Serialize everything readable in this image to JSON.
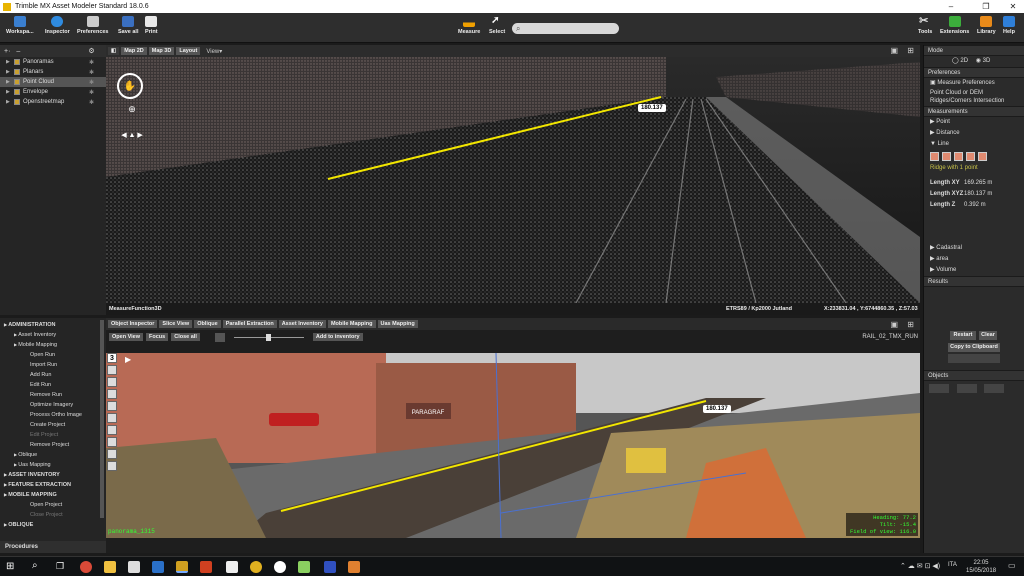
{
  "window": {
    "title": "Trimble MX Asset Modeler Standard 18.0.6"
  },
  "toolbar": {
    "workspace": "Workspa...",
    "inspector": "Inspector",
    "preferences": "Preferences",
    "save_all": "Save all",
    "print": "Print",
    "measure": "Measure",
    "select": "Select",
    "tools": "Tools",
    "extensions": "Extensions",
    "library": "Library",
    "help": "Help"
  },
  "layers": {
    "items": [
      {
        "label": "Panoramas"
      },
      {
        "label": "Planars"
      },
      {
        "label": "Point Cloud"
      },
      {
        "label": "Envelope"
      },
      {
        "label": "Openstreetmap"
      }
    ]
  },
  "view3d": {
    "map2d": "Map 2D",
    "map3d": "Map 3D",
    "layout": "Layout",
    "view_menu": "View▾",
    "status_left": "MeasureFunction3D",
    "crs": "ETRS89 / Kp2000 Jutland",
    "coords": "X:233831.04 , Y:6744860.35 , Z:57.03",
    "measure_label": "180.137"
  },
  "right_panel": {
    "mode": "Mode",
    "opt2d": "2D",
    "opt3d": "3D",
    "preferences": "Preferences",
    "measure_prefs": "Measure Preferences",
    "pref_text1": "Point Cloud or DEM",
    "pref_text2": "Ridges/Corners Intersection",
    "measurements": "Measurements",
    "point": "Point",
    "distance": "Distance",
    "line": "Line",
    "ridge_hint": "Ridge with 1 point",
    "length_xy_label": "Length XY",
    "length_xy": "169.265 m",
    "length_xyz_label": "Length XYZ",
    "length_xyz": "180.137 m",
    "length_z_label": "Length Z",
    "length_z": "0.392 m",
    "cadastral": "Cadastral",
    "area": "area",
    "volume": "Volume",
    "results": "Results",
    "restart": "Restart",
    "clear": "Clear",
    "copy": "Copy to Clipboard",
    "objects": "Objects"
  },
  "procedures": {
    "items": [
      {
        "label": "ADMINISTRATION",
        "level": 0,
        "bold": true,
        "disabled": false
      },
      {
        "label": "Asset Inventory",
        "level": 1,
        "bold": false,
        "disabled": false
      },
      {
        "label": "Mobile Mapping",
        "level": 1,
        "bold": false,
        "disabled": false
      },
      {
        "label": "Open Run",
        "level": 2,
        "bold": false,
        "disabled": false
      },
      {
        "label": "Import Run",
        "level": 2,
        "bold": false,
        "disabled": false
      },
      {
        "label": "Add Run",
        "level": 2,
        "bold": false,
        "disabled": false
      },
      {
        "label": "Edit Run",
        "level": 2,
        "bold": false,
        "disabled": false
      },
      {
        "label": "Remove Run",
        "level": 2,
        "bold": false,
        "disabled": false
      },
      {
        "label": "Optimize Imagery",
        "level": 2,
        "bold": false,
        "disabled": false
      },
      {
        "label": "Process Ortho Image",
        "level": 2,
        "bold": false,
        "disabled": false
      },
      {
        "label": "Create Project",
        "level": 2,
        "bold": false,
        "disabled": false
      },
      {
        "label": "Edit Project",
        "level": 2,
        "bold": false,
        "disabled": true
      },
      {
        "label": "Remove Project",
        "level": 2,
        "bold": false,
        "disabled": false
      },
      {
        "label": "Oblique",
        "level": 1,
        "bold": false,
        "disabled": false
      },
      {
        "label": "Uas Mapping",
        "level": 1,
        "bold": false,
        "disabled": false
      },
      {
        "label": "ASSET INVENTORY",
        "level": 0,
        "bold": true,
        "disabled": false
      },
      {
        "label": "FEATURE EXTRACTION",
        "level": 0,
        "bold": true,
        "disabled": false
      },
      {
        "label": "MOBILE MAPPING",
        "level": 0,
        "bold": true,
        "disabled": false
      },
      {
        "label": "Open Project",
        "level": 2,
        "bold": false,
        "disabled": false
      },
      {
        "label": "Close Project",
        "level": 2,
        "bold": false,
        "disabled": true
      },
      {
        "label": "OBLIQUE",
        "level": 0,
        "bold": true,
        "disabled": false
      }
    ],
    "footer": "Procedures"
  },
  "pano": {
    "tabs": [
      "Object Inspector",
      "Slice View",
      "Oblique",
      "Parallel Extraction",
      "Asset Inventory",
      "Mobile Mapping",
      "Uas Mapping"
    ],
    "open_view": "Open View",
    "focus": "Focus",
    "close_all": "Close all",
    "add_inventory": "Add to inventory",
    "run_name": "RAIL_02_TMX_RUN",
    "tool_number": "3",
    "panorama_id": "panorama_1315",
    "heading": "Heading:  77.2",
    "tilt": "Tilt:  -15.4",
    "fov": "Field of view: 116.0",
    "measure_label": "180.137",
    "sign": "PARAGRAF"
  },
  "taskbar": {
    "lang": "ITA",
    "time": "22:05",
    "date": "15/05/2018"
  },
  "colors": {
    "accent_yellow": "#f2e600",
    "bg": "#1b1b1b",
    "panel": "#2b2b2b"
  }
}
